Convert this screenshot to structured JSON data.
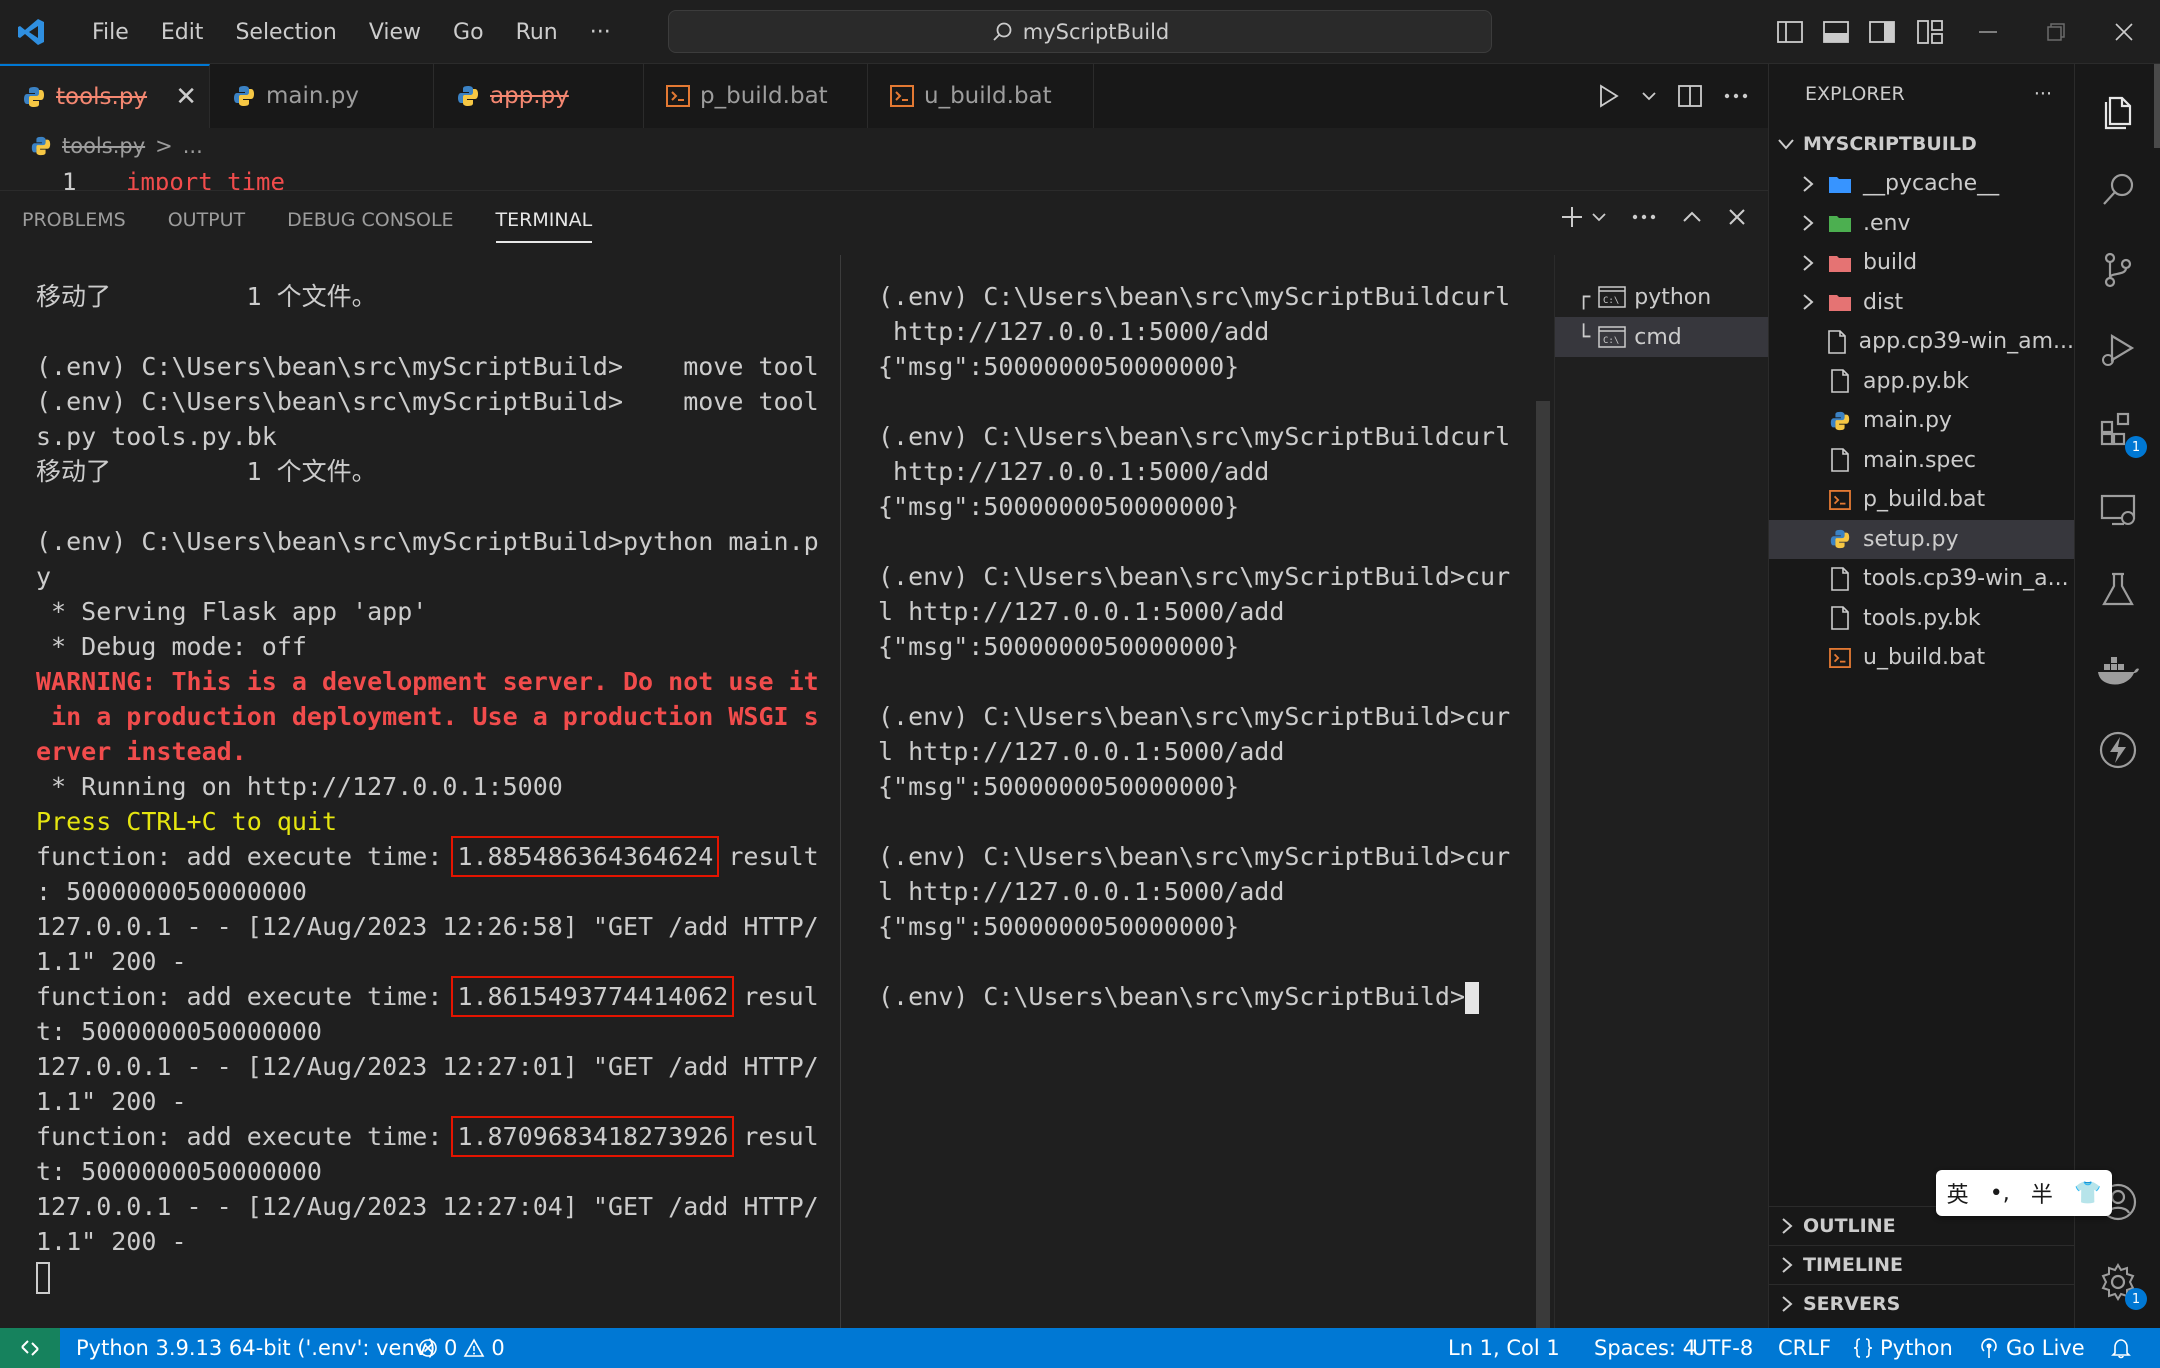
{
  "window": {
    "title": "myScriptBuild",
    "menu": [
      "File",
      "Edit",
      "Selection",
      "View",
      "Go",
      "Run",
      "···"
    ]
  },
  "tabs": [
    {
      "label": "tools.py",
      "icon": "python-icon",
      "deleted": true,
      "active": true
    },
    {
      "label": "main.py",
      "icon": "python-icon",
      "deleted": false,
      "active": false
    },
    {
      "label": "app.py",
      "icon": "python-icon",
      "deleted": true,
      "active": false
    },
    {
      "label": "p_build.bat",
      "icon": "terminal-file-icon",
      "deleted": false,
      "active": false
    },
    {
      "label": "u_build.bat",
      "icon": "terminal-file-icon",
      "deleted": false,
      "active": false
    }
  ],
  "breadcrumb": {
    "file": "tools.py",
    "separator": ">",
    "rest": "..."
  },
  "editor": {
    "line_number": "1",
    "code": "import time"
  },
  "panel": {
    "tabs": [
      "PROBLEMS",
      "OUTPUT",
      "DEBUG CONSOLE",
      "TERMINAL"
    ],
    "active_tab": "TERMINAL"
  },
  "terminal_left": [
    {
      "text": "移动了         1 个文件。"
    },
    {
      "text": ""
    },
    {
      "text": "(.env) C:\\Users\\bean\\src\\myScriptBuild>    move tool"
    },
    {
      "text": "(.env) C:\\Users\\bean\\src\\myScriptBuild>    move tool"
    },
    {
      "text": "s.py tools.py.bk"
    },
    {
      "text": "移动了         1 个文件。"
    },
    {
      "text": ""
    },
    {
      "text": "(.env) C:\\Users\\bean\\src\\myScriptBuild>python main.p"
    },
    {
      "text": "y"
    },
    {
      "text": " * Serving Flask app 'app'"
    },
    {
      "text": " * Debug mode: off"
    },
    {
      "text": "WARNING: This is a development server. Do not use it",
      "style": "red"
    },
    {
      "text": " in a production deployment. Use a production WSGI s",
      "style": "red"
    },
    {
      "text": "erver instead.",
      "style": "red"
    },
    {
      "text": " * Running on http://127.0.0.1:5000"
    },
    {
      "text": "Press CTRL+C to quit",
      "style": "yellow"
    },
    {
      "text": "function: add execute time: ",
      "hl": "1.885486364364624",
      "after": " result"
    },
    {
      "text": ": 5000000050000000"
    },
    {
      "text": "127.0.0.1 - - [12/Aug/2023 12:26:58] \"GET /add HTTP/"
    },
    {
      "text": "1.1\" 200 -"
    },
    {
      "text": "function: add execute time: ",
      "hl": "1.8615493774414062",
      "after": " resul"
    },
    {
      "text": "t: 5000000050000000"
    },
    {
      "text": "127.0.0.1 - - [12/Aug/2023 12:27:01] \"GET /add HTTP/"
    },
    {
      "text": "1.1\" 200 -"
    },
    {
      "text": "function: add execute time: ",
      "hl": "1.8709683418273926",
      "after": " resul"
    },
    {
      "text": "t: 5000000050000000"
    },
    {
      "text": "127.0.0.1 - - [12/Aug/2023 12:27:04] \"GET /add HTTP/"
    },
    {
      "text": "1.1\" 200 -"
    },
    {
      "text": "",
      "cursor": "hollow"
    }
  ],
  "terminal_right": [
    {
      "text": "(.env) C:\\Users\\bean\\src\\myScriptBuildcurl"
    },
    {
      "text": " http://127.0.0.1:5000/add"
    },
    {
      "text": "{\"msg\":5000000050000000}"
    },
    {
      "text": ""
    },
    {
      "text": "(.env) C:\\Users\\bean\\src\\myScriptBuildcurl"
    },
    {
      "text": " http://127.0.0.1:5000/add"
    },
    {
      "text": "{\"msg\":5000000050000000}"
    },
    {
      "text": ""
    },
    {
      "text": "(.env) C:\\Users\\bean\\src\\myScriptBuild>cur"
    },
    {
      "text": "l http://127.0.0.1:5000/add"
    },
    {
      "text": "{\"msg\":5000000050000000}"
    },
    {
      "text": ""
    },
    {
      "text": "(.env) C:\\Users\\bean\\src\\myScriptBuild>cur"
    },
    {
      "text": "l http://127.0.0.1:5000/add"
    },
    {
      "text": "{\"msg\":5000000050000000}"
    },
    {
      "text": ""
    },
    {
      "text": "(.env) C:\\Users\\bean\\src\\myScriptBuild>cur"
    },
    {
      "text": "l http://127.0.0.1:5000/add"
    },
    {
      "text": "{\"msg\":5000000050000000}"
    },
    {
      "text": ""
    },
    {
      "text": "(.env) C:\\Users\\bean\\src\\myScriptBuild>",
      "cursor": "solid"
    }
  ],
  "terminal_list": [
    {
      "prefix": "┌",
      "label": "python",
      "active": false
    },
    {
      "prefix": "└",
      "label": "cmd",
      "active": true
    }
  ],
  "explorer": {
    "header": "EXPLORER",
    "more": "···",
    "root": "MYSCRIPTBUILD",
    "items": [
      {
        "label": "__pycache__",
        "type": "folder",
        "icon": "folder-python-icon",
        "color": "#3794ff"
      },
      {
        "label": ".env",
        "type": "folder",
        "icon": "folder-env-icon",
        "color": "#4caf50"
      },
      {
        "label": "build",
        "type": "folder",
        "icon": "folder-build-icon",
        "color": "#e57373"
      },
      {
        "label": "dist",
        "type": "folder",
        "icon": "folder-dist-icon",
        "color": "#e57373"
      },
      {
        "label": "app.cp39-win_am...",
        "type": "file",
        "icon": "file-icon"
      },
      {
        "label": "app.py.bk",
        "type": "file",
        "icon": "file-icon"
      },
      {
        "label": "main.py",
        "type": "file",
        "icon": "python-icon"
      },
      {
        "label": "main.spec",
        "type": "file",
        "icon": "file-icon"
      },
      {
        "label": "p_build.bat",
        "type": "file",
        "icon": "terminal-file-icon"
      },
      {
        "label": "setup.py",
        "type": "file",
        "icon": "python-icon",
        "selected": true
      },
      {
        "label": "tools.cp39-win_a...",
        "type": "file",
        "icon": "file-icon"
      },
      {
        "label": "tools.py.bk",
        "type": "file",
        "icon": "file-icon"
      },
      {
        "label": "u_build.bat",
        "type": "file",
        "icon": "terminal-file-icon"
      }
    ],
    "sections": [
      "OUTLINE",
      "TIMELINE",
      "SERVERS"
    ]
  },
  "activity": {
    "extensions_badge": "1",
    "settings_badge": "1"
  },
  "ime": [
    "英",
    "•,",
    "半",
    "👕"
  ],
  "statusbar": {
    "interpreter": "Python 3.9.13 64-bit ('.env': venv)",
    "errors": "0",
    "warnings": "0",
    "position": "Ln 1, Col 1",
    "spaces": "Spaces: 4",
    "encoding": "UTF-8",
    "eol": "CRLF",
    "language": "Python",
    "golive": "Go Live"
  },
  "colors": {
    "accent": "#0078d4",
    "status_remote": "#16825d",
    "terminal_red": "#f14c4c",
    "terminal_yellow": "#e5e510",
    "highlight_box": "#e51400"
  }
}
